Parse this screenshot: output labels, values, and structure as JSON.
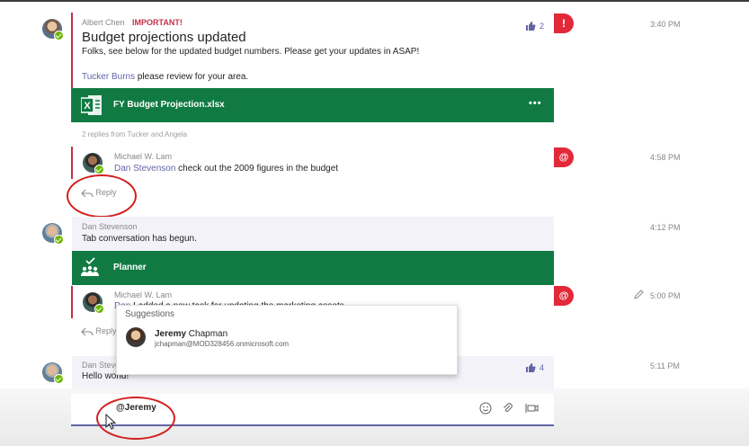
{
  "thread1": {
    "author": "Albert Chen",
    "important": "IMPORTANT!",
    "title": "Budget projections updated",
    "body": "Folks, see below for the updated budget numbers. Please get your updates in ASAP!",
    "mention": "Tucker Burns",
    "mention_rest": " please review for your area.",
    "attachment": "FY Budget Projection.xlsx",
    "attachment_menu": "•••",
    "likes": "2",
    "badge": "!",
    "time": "3:40 PM",
    "replies_summary": "2 replies from Tucker and Angela",
    "reply": {
      "author": "Michael W. Lam",
      "mention": "Dan Stevenson",
      "text": " check out the 2009 figures in the budget",
      "badge": "@",
      "time": "4:58 PM"
    },
    "reply_label": "Reply"
  },
  "thread2": {
    "author": "Dan Stevenson",
    "body": "Tab conversation has begun.",
    "time": "4:12 PM",
    "card": "Planner",
    "reply": {
      "author": "Michael W. Lam",
      "mention": "Dan",
      "text": " I added a new task for updating the marketing assets",
      "badge": "@",
      "time": "5:00 PM"
    },
    "reply_label": "Reply"
  },
  "thread3": {
    "author": "Dan Stevenson",
    "body": "Hello world!",
    "likes": "4",
    "time": "5:11 PM"
  },
  "suggestions": {
    "header": "Suggestions",
    "first": "Jeremy",
    "last": " Chapman",
    "email": "jchapman@MOD328456.onmicrosoft.com"
  },
  "compose": {
    "value": "@Jeremy"
  },
  "colors": {
    "accent": "#6264a7",
    "excel_green": "#117a43",
    "alert_red": "#e2293a",
    "annotation_red": "#d21f1f"
  }
}
